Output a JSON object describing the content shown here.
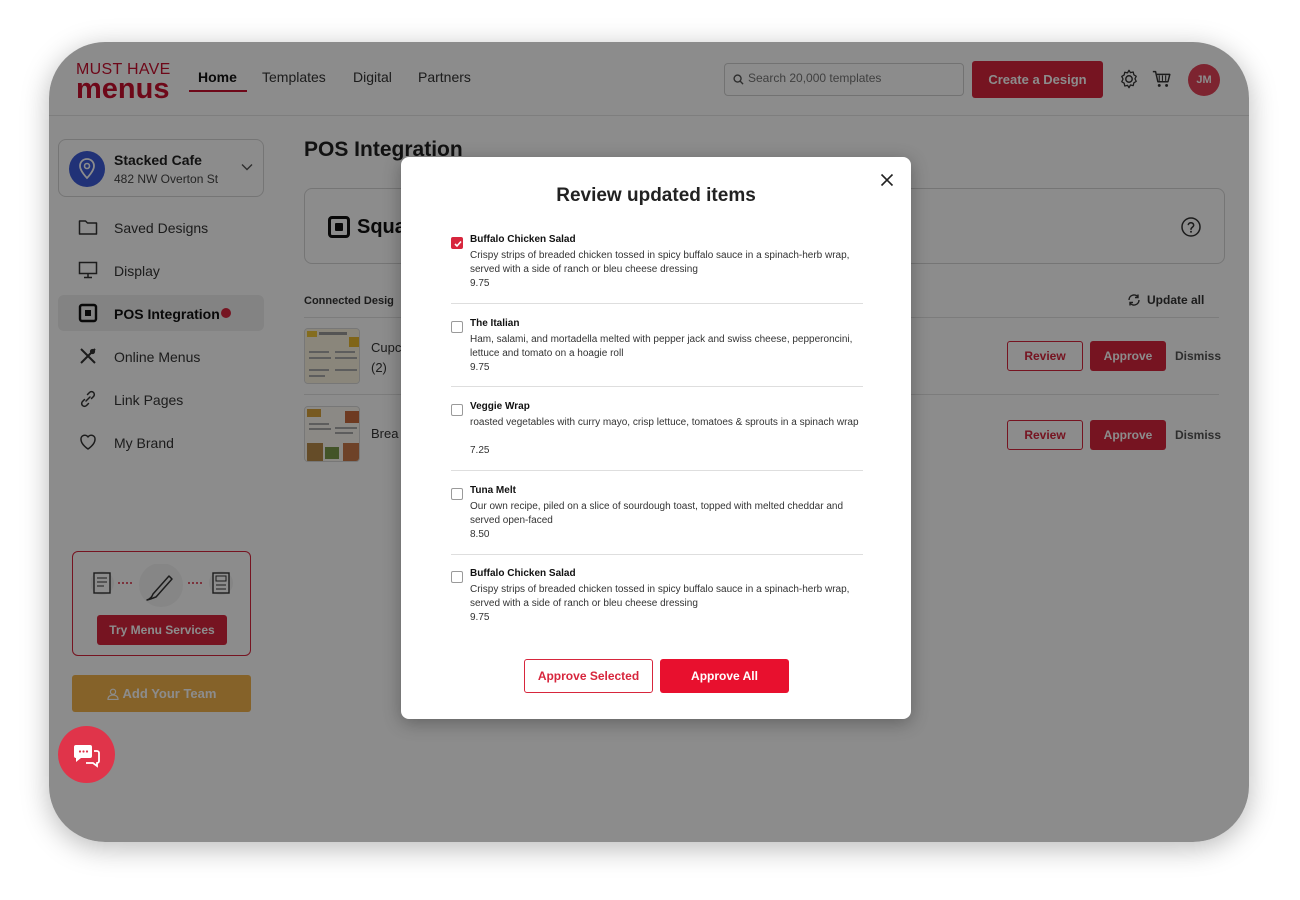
{
  "header": {
    "logo_line1": "MUST HAVE",
    "logo_line2": "menus",
    "nav": [
      "Home",
      "Templates",
      "Digital",
      "Partners"
    ],
    "search_placeholder": "Search 20,000 templates",
    "create_button": "Create a Design",
    "avatar_initials": "JM"
  },
  "sidebar": {
    "location_name": "Stacked Cafe",
    "location_address": "482 NW Overton St",
    "items": [
      {
        "label": "Saved Designs",
        "icon": "folder-icon"
      },
      {
        "label": "Display",
        "icon": "monitor-icon"
      },
      {
        "label": "POS Integration",
        "icon": "pos-square-icon",
        "active": true,
        "alert": true
      },
      {
        "label": "Online Menus",
        "icon": "utensils-icon"
      },
      {
        "label": "Link Pages",
        "icon": "link-icon"
      },
      {
        "label": "My Brand",
        "icon": "heart-icon"
      }
    ],
    "promo_button": "Try Menu Services",
    "team_button": "Add Your Team"
  },
  "main": {
    "title": "POS Integration",
    "provider_text": "Squa",
    "connected_label": "Connected Desig",
    "update_all": "Update all",
    "rows": [
      {
        "name_line1": "Cupc",
        "name_line2": "(2)"
      },
      {
        "name_line1": "Brea",
        "name_line2": ""
      }
    ],
    "review_label": "Review",
    "approve_label": "Approve",
    "dismiss_label": "Dismiss"
  },
  "modal": {
    "title": "Review updated items",
    "items": [
      {
        "name": "Buffalo Chicken Salad",
        "description": "Crispy strips of breaded chicken tossed in spicy buffalo sauce in a spinach-herb wrap, served with a side of ranch or bleu cheese dressing",
        "price": "9.75",
        "checked": true
      },
      {
        "name": "The Italian",
        "description": "Ham, salami, and mortadella melted with pepper jack and swiss cheese, pepperoncini, lettuce and tomato on a hoagie roll",
        "price": "9.75",
        "checked": false
      },
      {
        "name": "Veggie Wrap",
        "description": "roasted vegetables with curry mayo, crisp lettuce, tomatoes & sprouts in a spinach wrap",
        "price": "7.25",
        "checked": false
      },
      {
        "name": "Tuna Melt",
        "description": "Our own recipe, piled on a slice of sourdough toast, topped with melted cheddar and served open-faced",
        "price": "8.50",
        "checked": false
      },
      {
        "name": "Buffalo Chicken Salad",
        "description": "Crispy strips of breaded chicken tossed in spicy buffalo sauce in a spinach-herb wrap, served with a side of ranch or bleu cheese dressing",
        "price": "9.75",
        "checked": false
      }
    ],
    "approve_selected": "Approve Selected",
    "approve_all": "Approve All"
  },
  "colors": {
    "brand_red": "#d7263d",
    "accent_red": "#e8102e",
    "team_orange": "#f3b34c",
    "location_blue": "#3d5bd9"
  }
}
